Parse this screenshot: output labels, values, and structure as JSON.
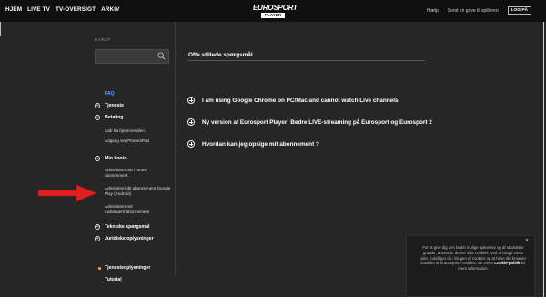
{
  "topbar": {
    "nav": [
      "HJEM",
      "LIVE TV",
      "TV-OVERSIGT",
      "ARKIV"
    ],
    "logo_top": "EUROSPORT",
    "logo_bottom": "PLAYER",
    "help": "Hjælp",
    "gift": "Send en gave til spilleren",
    "login": "LOG PÅ"
  },
  "sidebar": {
    "label": "HJÆLP",
    "search_placeholder": "",
    "faq": "FAQ",
    "tjeneste": "Tjeneste",
    "betaling": "Betaling",
    "betaling_sub": [
      "Køb fra hjemmesiden.",
      "Adgang via iPhone/iPad"
    ],
    "min_konto": "Min konto",
    "min_konto_sub": [
      "Administrer mit iTunes-abonnement",
      "Administrer dit abonnement Google Play (Android)",
      "Administrer mit multiskærmabonnement"
    ],
    "tekniske": "Tekniske spørgsmål",
    "juridiske": "Juridiske oplysninger",
    "tjenesteoplysninger": "Tjenesteoplysninger",
    "tutorial": "Tutorial"
  },
  "main": {
    "title": "Ofte stillede spørgsmål",
    "questions": [
      "I am using Google Chrome on PC/Mac and cannot watch Live channels.",
      "Ny version af Eurosport Player: Bedre LIVE-streaming på Eurosport og Eurosport 2",
      "Hvordan kan jeg opsige mit abonnement ?"
    ]
  },
  "cookie": {
    "close": "×",
    "text_before": "For at give dig den bedst mulige oplevelse og af statistiske grunde, anvender denne side cookies. Ved at bruge vores side, indvilliger du i brugen af cookies og at have din browser indstillet til at acceptere cookies. Se vores ",
    "link": "Cookie-politik",
    "text_after": " for mere information."
  },
  "colors": {
    "accent": "#4da3ff",
    "bullet": "#f5b800",
    "arrow": "#e02020",
    "background": "#262626"
  }
}
